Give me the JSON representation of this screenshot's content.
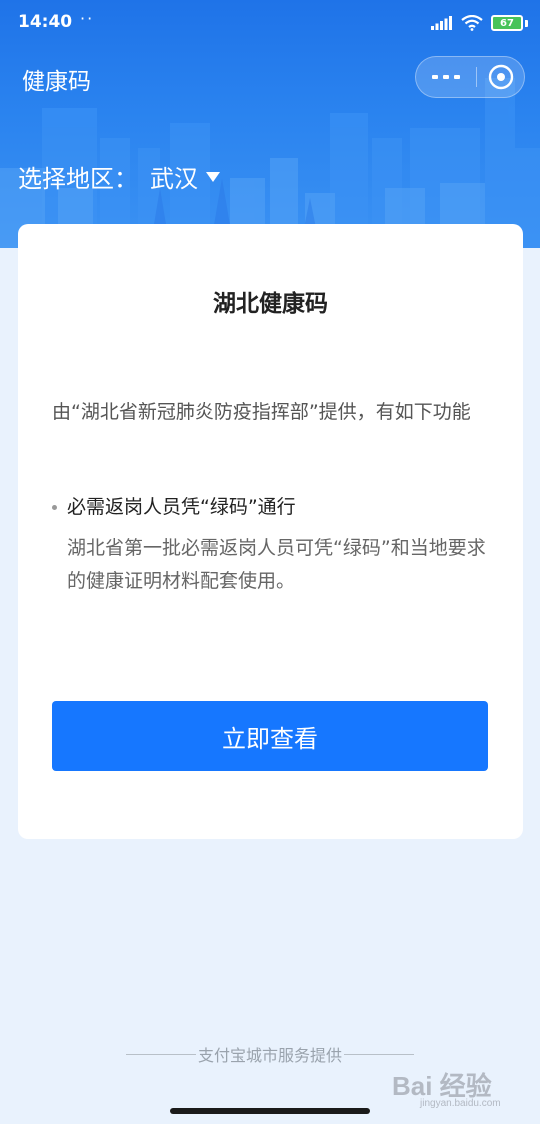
{
  "status_bar": {
    "time": "14:40",
    "dots": "··",
    "battery_level": "67",
    "icons": [
      "signal-icon",
      "wifi-icon",
      "battery-icon"
    ]
  },
  "app": {
    "title": "健康码",
    "more_icon": "more-dots-icon",
    "close_icon": "close-circle-icon"
  },
  "region": {
    "label": "选择地区：",
    "value": "武汉",
    "caret_icon": "caret-down-icon"
  },
  "card": {
    "title": "湖北健康码",
    "description": "由“湖北省新冠肺炎防疫指挥部”提供，有如下功能",
    "feature": {
      "title": "必需返岗人员凭“绿码”通行",
      "description": "湖北省第一批必需返岗人员可凭“绿码”和当地要求的健康证明材料配套使用。"
    },
    "button_label": "立即查看"
  },
  "footer": {
    "text": "支付宝城市服务提供"
  },
  "watermark": {
    "brand": "Bai 经验",
    "url": "jingyan.baidu.com"
  },
  "colors": {
    "header_blue": "#1f73e8",
    "button_blue": "#1677ff",
    "page_bg": "#e9f2fd",
    "battery_green": "#47c35a"
  }
}
